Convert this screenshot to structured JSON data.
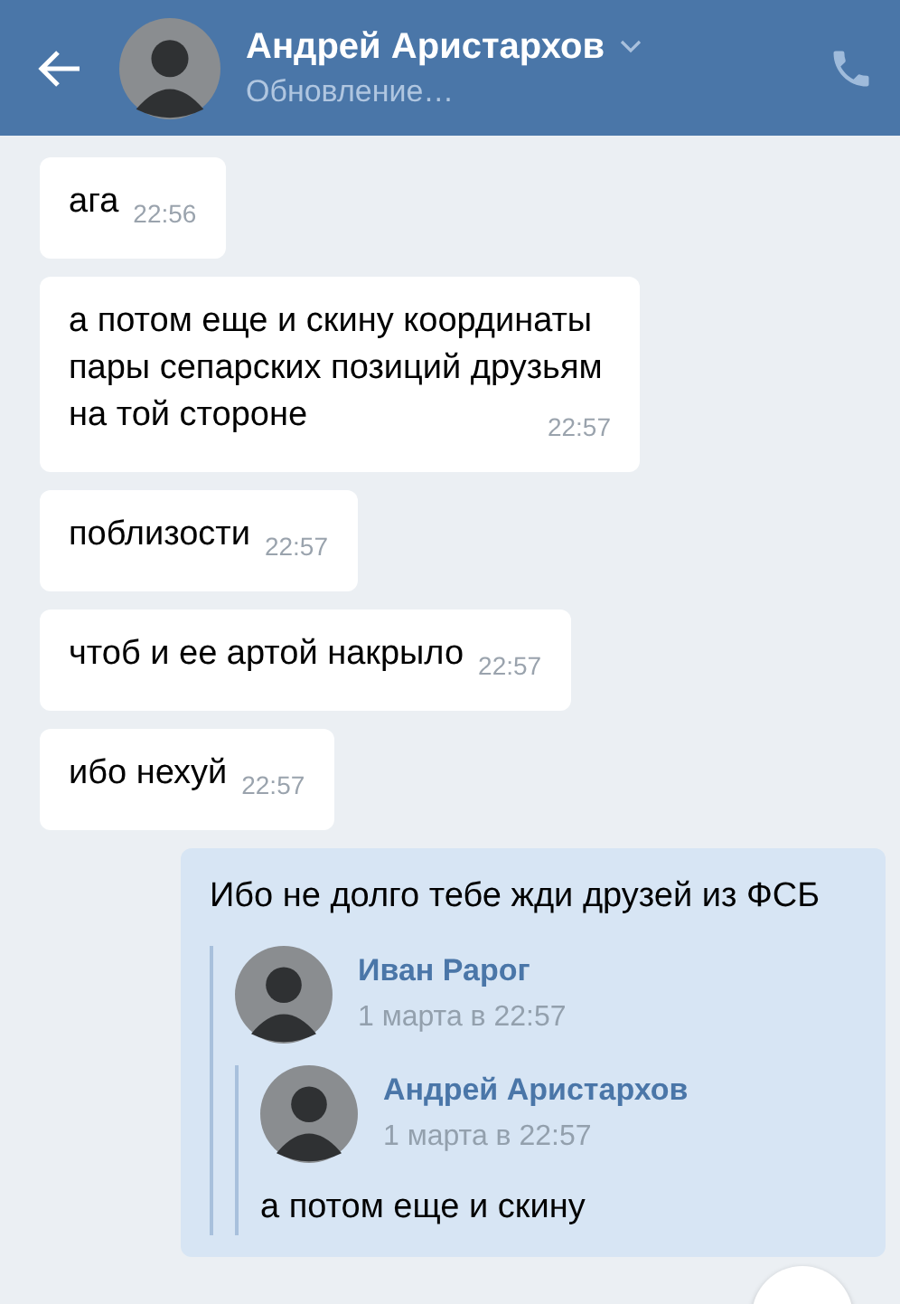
{
  "header": {
    "title": "Андрей Аристархов",
    "status": "Обновление…"
  },
  "messages": [
    {
      "kind": "incoming",
      "text": "ага",
      "time": "22:56"
    },
    {
      "kind": "incoming",
      "text": "а потом еще и скину координаты пары сепарских позиций друзьям на той стороне",
      "time": "22:57"
    },
    {
      "kind": "incoming",
      "text": "поблизости",
      "time": "22:57"
    },
    {
      "kind": "incoming",
      "text": "чтоб и ее артой накрыло",
      "time": "22:57"
    },
    {
      "kind": "incoming",
      "text": "ибо нехуй",
      "time": "22:57"
    },
    {
      "kind": "outgoing",
      "text": "Ибо не долго тебе жди друзей из ФСБ",
      "forwarded": {
        "author": "Иван Рарог",
        "date": "1 марта в 22:57",
        "forwarded": {
          "author": "Андрей Аристархов",
          "date": "1 марта в 22:57",
          "text": "а потом еще и скину"
        }
      }
    }
  ]
}
